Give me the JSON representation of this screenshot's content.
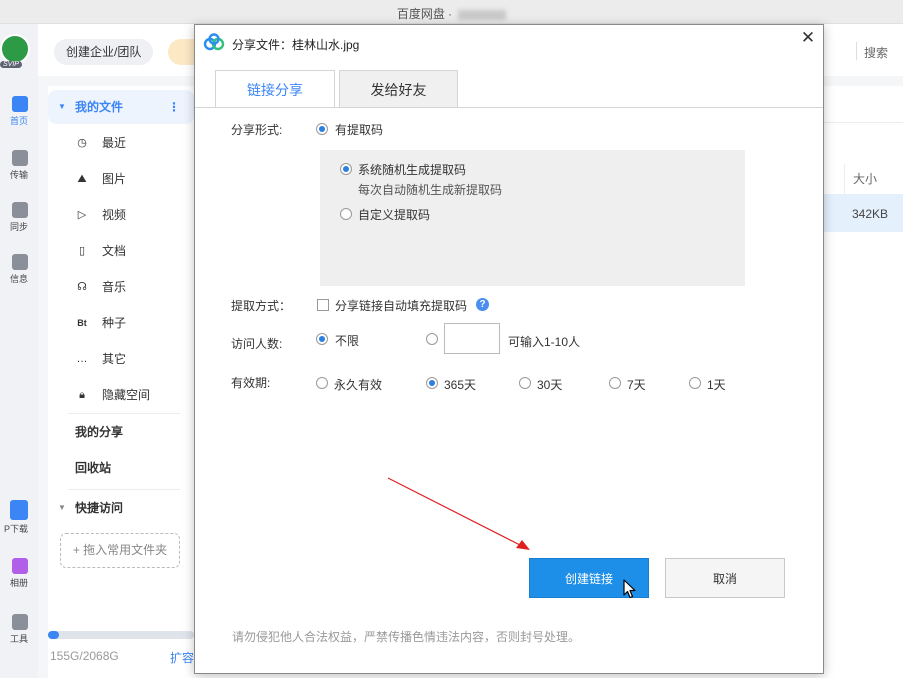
{
  "app": {
    "window_title": "百度网盘 ·",
    "team_button": "创建企业/团队",
    "search_label": "搜索",
    "rail": {
      "home": "首页",
      "transfer": "传输",
      "sync": "同步",
      "messages": "信息",
      "app_download": "APP下载",
      "album": "一刻相册",
      "tools": "工具"
    },
    "rail_visible": {
      "home": "首页",
      "transfer": "传输",
      "sync": "同步",
      "messages": "信息",
      "app_download": "P下载",
      "album": "相册",
      "tools": "工具"
    },
    "sidebar": {
      "my_files": "我的文件",
      "items": [
        {
          "label": "最近",
          "icon": "clock-icon"
        },
        {
          "label": "图片",
          "icon": "mountain-icon"
        },
        {
          "label": "视频",
          "icon": "play-icon"
        },
        {
          "label": "文档",
          "icon": "document-icon"
        },
        {
          "label": "音乐",
          "icon": "headphones-icon"
        },
        {
          "label": "种子",
          "icon": "bt-icon"
        },
        {
          "label": "其它",
          "icon": "ellipsis-icon"
        },
        {
          "label": "隐藏空间",
          "icon": "lock-icon"
        }
      ],
      "my_share": "我的分享",
      "recycle": "回收站",
      "quick_access": "快捷访问",
      "drop_hint": "+ 拖入常用文件夹",
      "storage": "155G/2068G",
      "storage_fraction": 0.075,
      "expand": "扩容"
    },
    "file_table": {
      "size_header": "大小",
      "selected_size": "342KB"
    }
  },
  "dialog": {
    "title": "分享文件：桂林山水.jpg",
    "close": "✕",
    "tabs": [
      "链接分享",
      "发给好友"
    ],
    "share_form_label": "分享形式:",
    "share_form_option": "有提取码",
    "code_options": {
      "random": "系统随机生成提取码",
      "random_sub": "每次自动随机生成新提取码",
      "custom": "自定义提取码"
    },
    "extract_label": "提取方式：",
    "extract_auto_fill": "分享链接自动填充提取码",
    "help": "?",
    "visitors_label": "访问人数:",
    "visitors_unlimited": "不限",
    "visitors_input_value": "",
    "visitors_hint": "可输入1-10人",
    "validity_label": "有效期:",
    "validity_options": [
      "永久有效",
      "365天",
      "30天",
      "7天",
      "1天"
    ],
    "validity_selected": "365天",
    "create_button": "创建链接",
    "cancel_button": "取消",
    "notice": "请勿侵犯他人合法权益，严禁传播色情违法内容，否则封号处理。"
  },
  "colors": {
    "accent": "#1e8fe8",
    "tab_active": "#3b85f5",
    "annotation_arrow": "#e02020"
  }
}
